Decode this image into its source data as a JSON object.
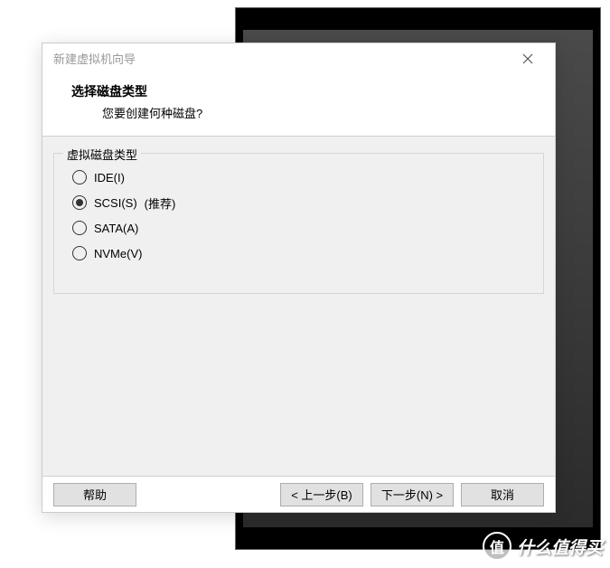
{
  "dialog": {
    "title": "新建虚拟机向导",
    "header": {
      "title": "选择磁盘类型",
      "subtitle": "您要创建何种磁盘?"
    },
    "group": {
      "legend": "虚拟磁盘类型",
      "options": [
        {
          "label": "IDE(I)",
          "extra": "",
          "selected": false
        },
        {
          "label": "SCSI(S)",
          "extra": "(推荐)",
          "selected": true
        },
        {
          "label": "SATA(A)",
          "extra": "",
          "selected": false
        },
        {
          "label": "NVMe(V)",
          "extra": "",
          "selected": false
        }
      ]
    },
    "buttons": {
      "help": "帮助",
      "back": "< 上一步(B)",
      "next": "下一步(N) >",
      "cancel": "取消"
    }
  },
  "watermark": {
    "badge": "值",
    "text": "什么值得买"
  }
}
